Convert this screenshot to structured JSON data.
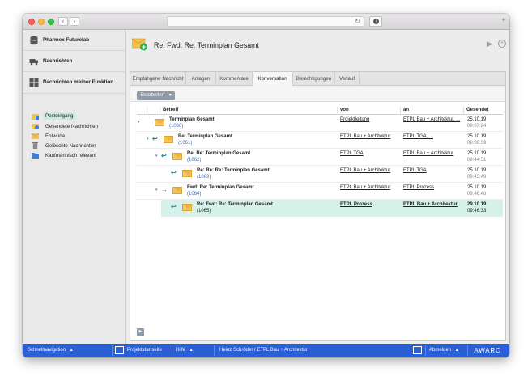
{
  "browser": {
    "back": "‹",
    "forward": "›",
    "reload": "↻",
    "download": "↓",
    "new_tab": "+"
  },
  "sidebar": {
    "sections": [
      {
        "label": "Pharmex Futurelab",
        "icon": "database-icon"
      },
      {
        "label": "Nachrichten",
        "icon": "truck-icon"
      },
      {
        "label": "Nachrichten meiner Funktion",
        "icon": "grid-icon"
      }
    ],
    "items": [
      {
        "label": "Posteingang",
        "icon": "inbox-icon",
        "active": true
      },
      {
        "label": "Gesendete Nachrichten",
        "icon": "sent-icon"
      },
      {
        "label": "Entwürfe",
        "icon": "draft-envelope-icon"
      },
      {
        "label": "Gelöschte Nachrichten",
        "icon": "trash-icon"
      },
      {
        "label": "Kaufmännisch relevant",
        "icon": "folder-icon"
      }
    ]
  },
  "header": {
    "title": "Re: Fwd: Re: Terminplan Gesamt",
    "play": "▶",
    "close": "×"
  },
  "tabs": [
    {
      "label": "Empfangene Nachricht"
    },
    {
      "label": "Anlagen"
    },
    {
      "label": "Kommentare"
    },
    {
      "label": "Konversation",
      "active": true
    },
    {
      "label": "Berechtigungen"
    },
    {
      "label": "Verlauf"
    }
  ],
  "toolbar": {
    "edit_label": "Bearbeiten",
    "edit_caret": "▼"
  },
  "grid": {
    "columns": [
      "Betreff",
      "von",
      "an",
      "Gesendet"
    ],
    "rows": [
      {
        "subject": "Terminplan Gesamt",
        "number": "(1060)",
        "from": "Projektleitung",
        "to": "ETPL Bau + Architektur, ...",
        "date": "25.10.19",
        "time": "09:07:24",
        "caret": "▾",
        "arrow": "",
        "selected": false
      },
      {
        "subject": "Re: Terminplan Gesamt",
        "number": "(1061)",
        "from": "ETPL Bau + Architektur",
        "to": "ETPL TGA, ...",
        "date": "25.10.19",
        "time": "09:08:59",
        "caret": "▾",
        "arrow": "↩",
        "selected": false
      },
      {
        "subject": "Re: Re: Terminplan Gesamt",
        "number": "(1062)",
        "from": "ETPL TGA",
        "to": "ETPL Bau + Architektur",
        "date": "25.10.19",
        "time": "09:44:51",
        "caret": "▾",
        "arrow": "↩",
        "selected": false
      },
      {
        "subject": "Re: Re: Re: Terminplan Gesamt",
        "number": "(1063)",
        "from": "ETPL Bau + Architektur",
        "to": "ETPL TGA",
        "date": "25.10.19",
        "time": "09:45:49",
        "caret": "",
        "arrow": "↩",
        "selected": false
      },
      {
        "subject": "Fwd: Re: Terminplan Gesamt",
        "number": "(1064)",
        "from": "ETPL Bau + Architektur",
        "to": "ETPL Prozess",
        "date": "25.10.19",
        "time": "09:46:48",
        "caret": "▾",
        "arrow": "→",
        "selected": false
      },
      {
        "subject": "Re: Fwd: Re: Terminplan Gesamt",
        "number": "(1065)",
        "from": "ETPL Prozess",
        "to": "ETPL Bau + Architektur",
        "date": "29.10.19",
        "time": "09:46:33",
        "caret": "",
        "arrow": "↩",
        "selected": true
      }
    ]
  },
  "panel_footer_button": "▶",
  "statusbar": {
    "quicknav": "Schnellnavigation",
    "quicknav_caret": "▲",
    "home": "Projektstartseite",
    "help": "Hilfe",
    "help_caret": "▲",
    "user": "Heinz Schröder / ETPL Bau + Architektur",
    "logout": "Abmelden",
    "logout_caret": "▲",
    "brand": "AWARO"
  }
}
